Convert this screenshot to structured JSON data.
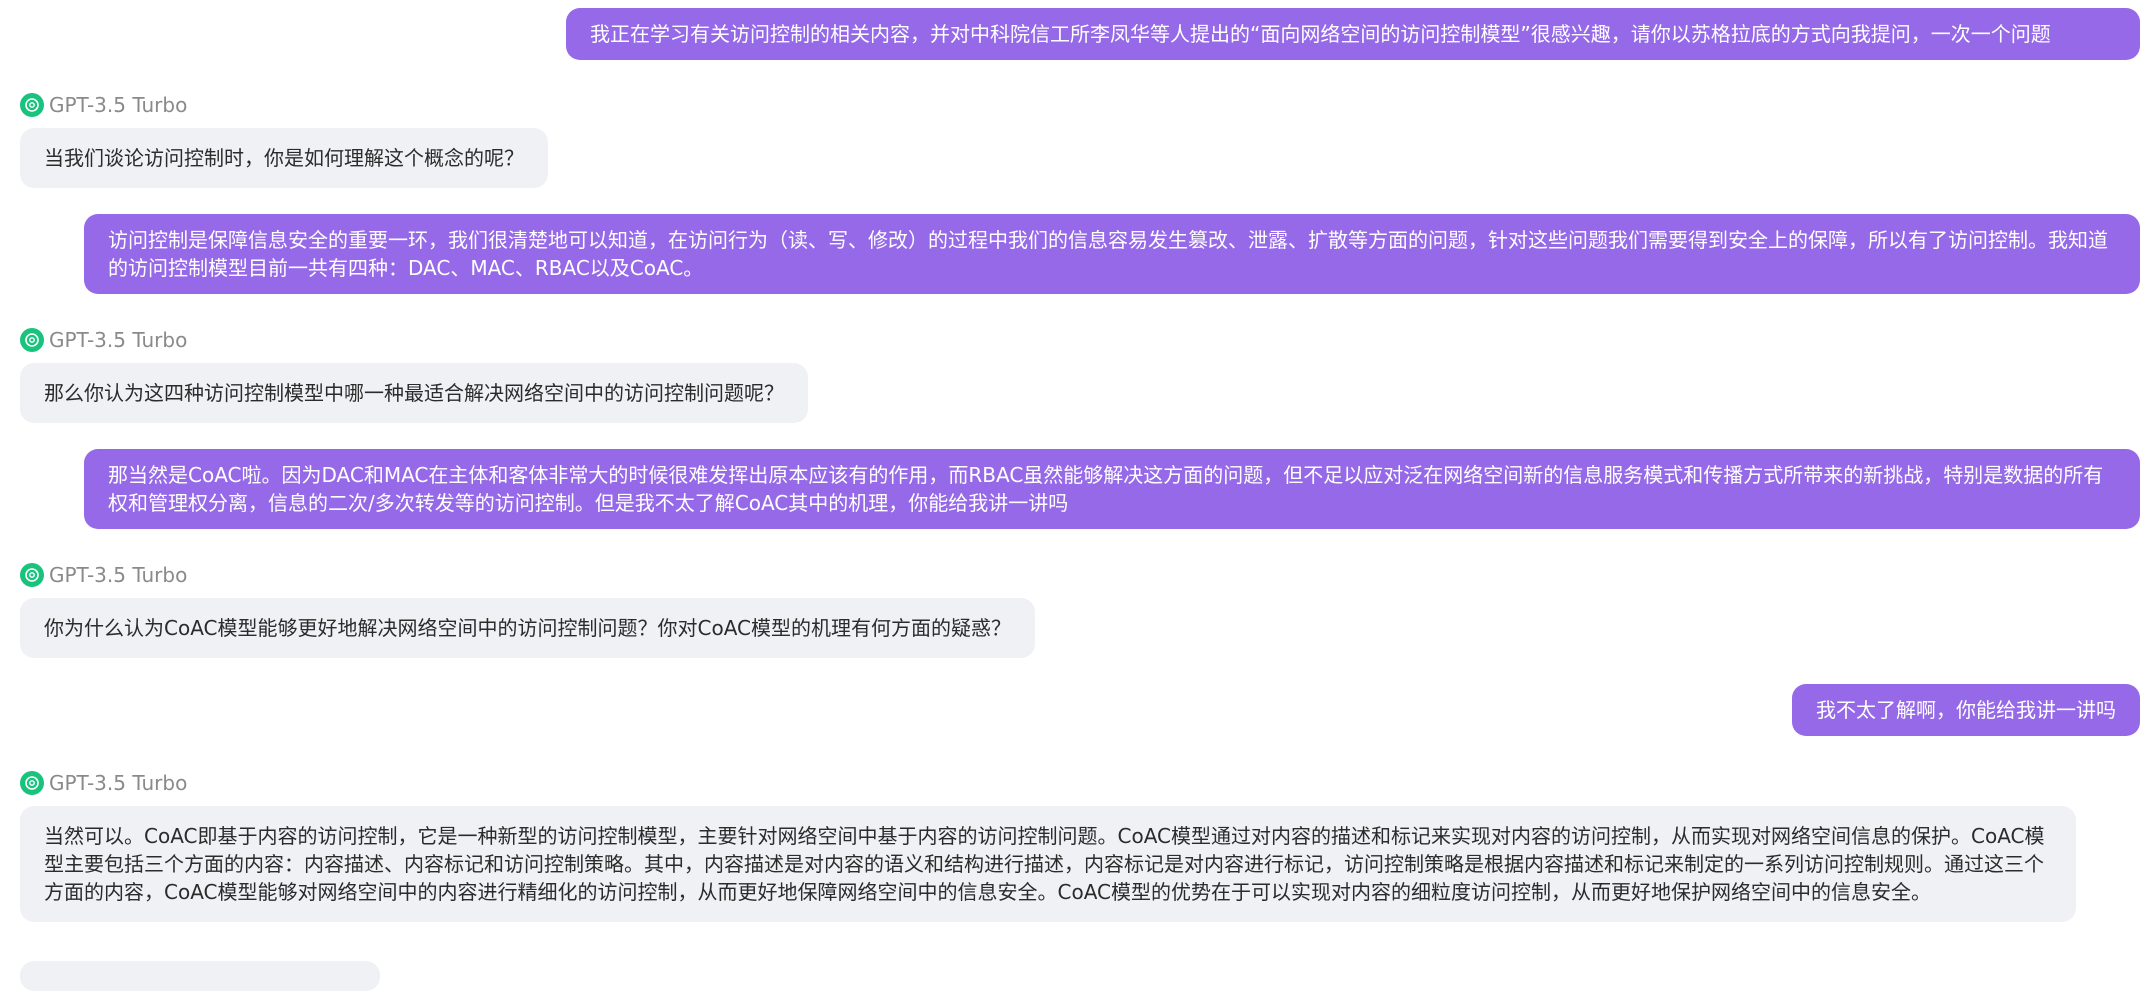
{
  "model_name": "GPT-3.5 Turbo",
  "messages": [
    {
      "role": "user",
      "text": "我正在学习有关访问控制的相关内容，并对中科院信工所李凤华等人提出的“面向网络空间的访问控制模型”很感兴趣，请你以苏格拉底的方式向我提问，一次一个问题"
    },
    {
      "role": "assistant",
      "text": "当我们谈论访问控制时，你是如何理解这个概念的呢？"
    },
    {
      "role": "user",
      "text": "访问控制是保障信息安全的重要一环，我们很清楚地可以知道，在访问行为（读、写、修改）的过程中我们的信息容易发生篡改、泄露、扩散等方面的问题，针对这些问题我们需要得到安全上的保障，所以有了访问控制。我知道的访问控制模型目前一共有四种：DAC、MAC、RBAC以及CoAC。"
    },
    {
      "role": "assistant",
      "text": "那么你认为这四种访问控制模型中哪一种最适合解决网络空间中的访问控制问题呢？"
    },
    {
      "role": "user",
      "text": "那当然是CoAC啦。因为DAC和MAC在主体和客体非常大的时候很难发挥出原本应该有的作用，而RBAC虽然能够解决这方面的问题，但不足以应对泛在网络空间新的信息服务模式和传播方式所带来的新挑战，特别是数据的所有权和管理权分离，信息的二次/多次转发等的访问控制。但是我不太了解CoAC其中的机理，你能给我讲一讲吗"
    },
    {
      "role": "assistant",
      "text": "你为什么认为CoAC模型能够更好地解决网络空间中的访问控制问题？你对CoAC模型的机理有何方面的疑惑？"
    },
    {
      "role": "user",
      "text": "我不太了解啊，你能给我讲一讲吗"
    },
    {
      "role": "assistant",
      "text": "当然可以。CoAC即基于内容的访问控制，它是一种新型的访问控制模型，主要针对网络空间中基于内容的访问控制问题。CoAC模型通过对内容的描述和标记来实现对内容的访问控制，从而实现对网络空间信息的保护。CoAC模型主要包括三个方面的内容：内容描述、内容标记和访问控制策略。其中，内容描述是对内容的语义和结构进行描述，内容标记是对内容进行标记，访问控制策略是根据内容描述和标记来制定的一系列访问控制规则。通过这三个方面的内容，CoAC模型能够对网络空间中的内容进行精细化的访问控制，从而更好地保障网络空间中的信息安全。CoAC模型的优势在于可以实现对内容的细粒度访问控制，从而更好地保护网络空间中的信息安全。"
    }
  ],
  "icons": {
    "model_avatar": "openai-logo-icon"
  },
  "colors": {
    "user_bubble": "#9569e8",
    "assistant_bubble": "#f0f1f4",
    "model_icon": "#19c37d"
  }
}
